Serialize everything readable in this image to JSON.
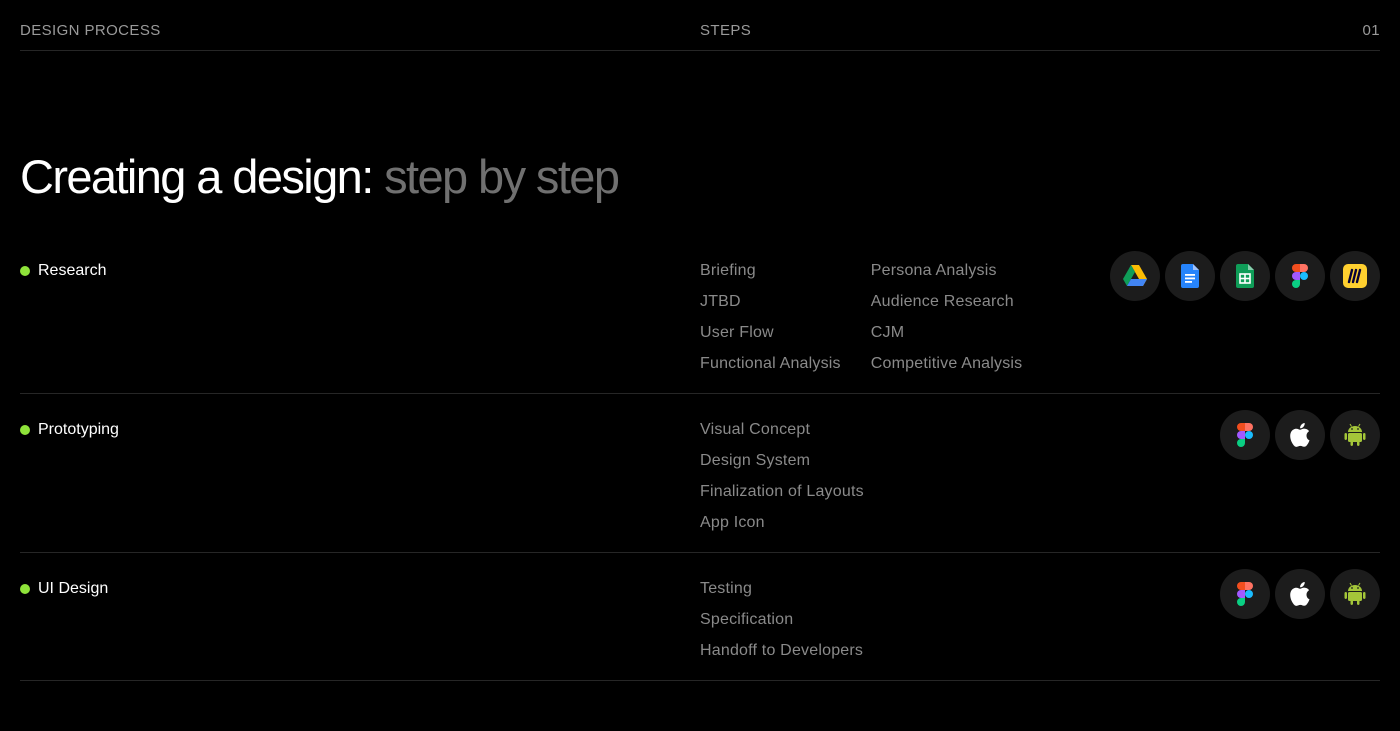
{
  "header": {
    "section": "DESIGN PROCESS",
    "label": "STEPS",
    "number": "01"
  },
  "title": {
    "main": "Creating a design:",
    "accent": "step by step"
  },
  "colors": {
    "background": "#000000",
    "dot": "#8fe33a",
    "muted_text": "#8a8a8a",
    "divider": "#262626"
  },
  "steps": [
    {
      "name": "Research",
      "tasks_col1": [
        "Briefing",
        "JTBD",
        "User Flow",
        "Functional Analysis"
      ],
      "tasks_col2": [
        "Persona Analysis",
        "Audience Research",
        "CJM",
        "Competitive Analysis"
      ],
      "tools": [
        "google-drive-icon",
        "google-docs-icon",
        "google-sheets-icon",
        "figma-icon",
        "miro-icon"
      ]
    },
    {
      "name": "Prototyping",
      "tasks_col1": [
        "Visual Concept",
        "Design System",
        "Finalization of Layouts",
        "App Icon"
      ],
      "tools": [
        "figma-icon",
        "apple-icon",
        "android-icon"
      ]
    },
    {
      "name": "UI Design",
      "tasks_col1": [
        "Testing",
        "Specification",
        "Handoff to Developers"
      ],
      "tools": [
        "figma-icon",
        "apple-icon",
        "android-icon"
      ]
    }
  ]
}
